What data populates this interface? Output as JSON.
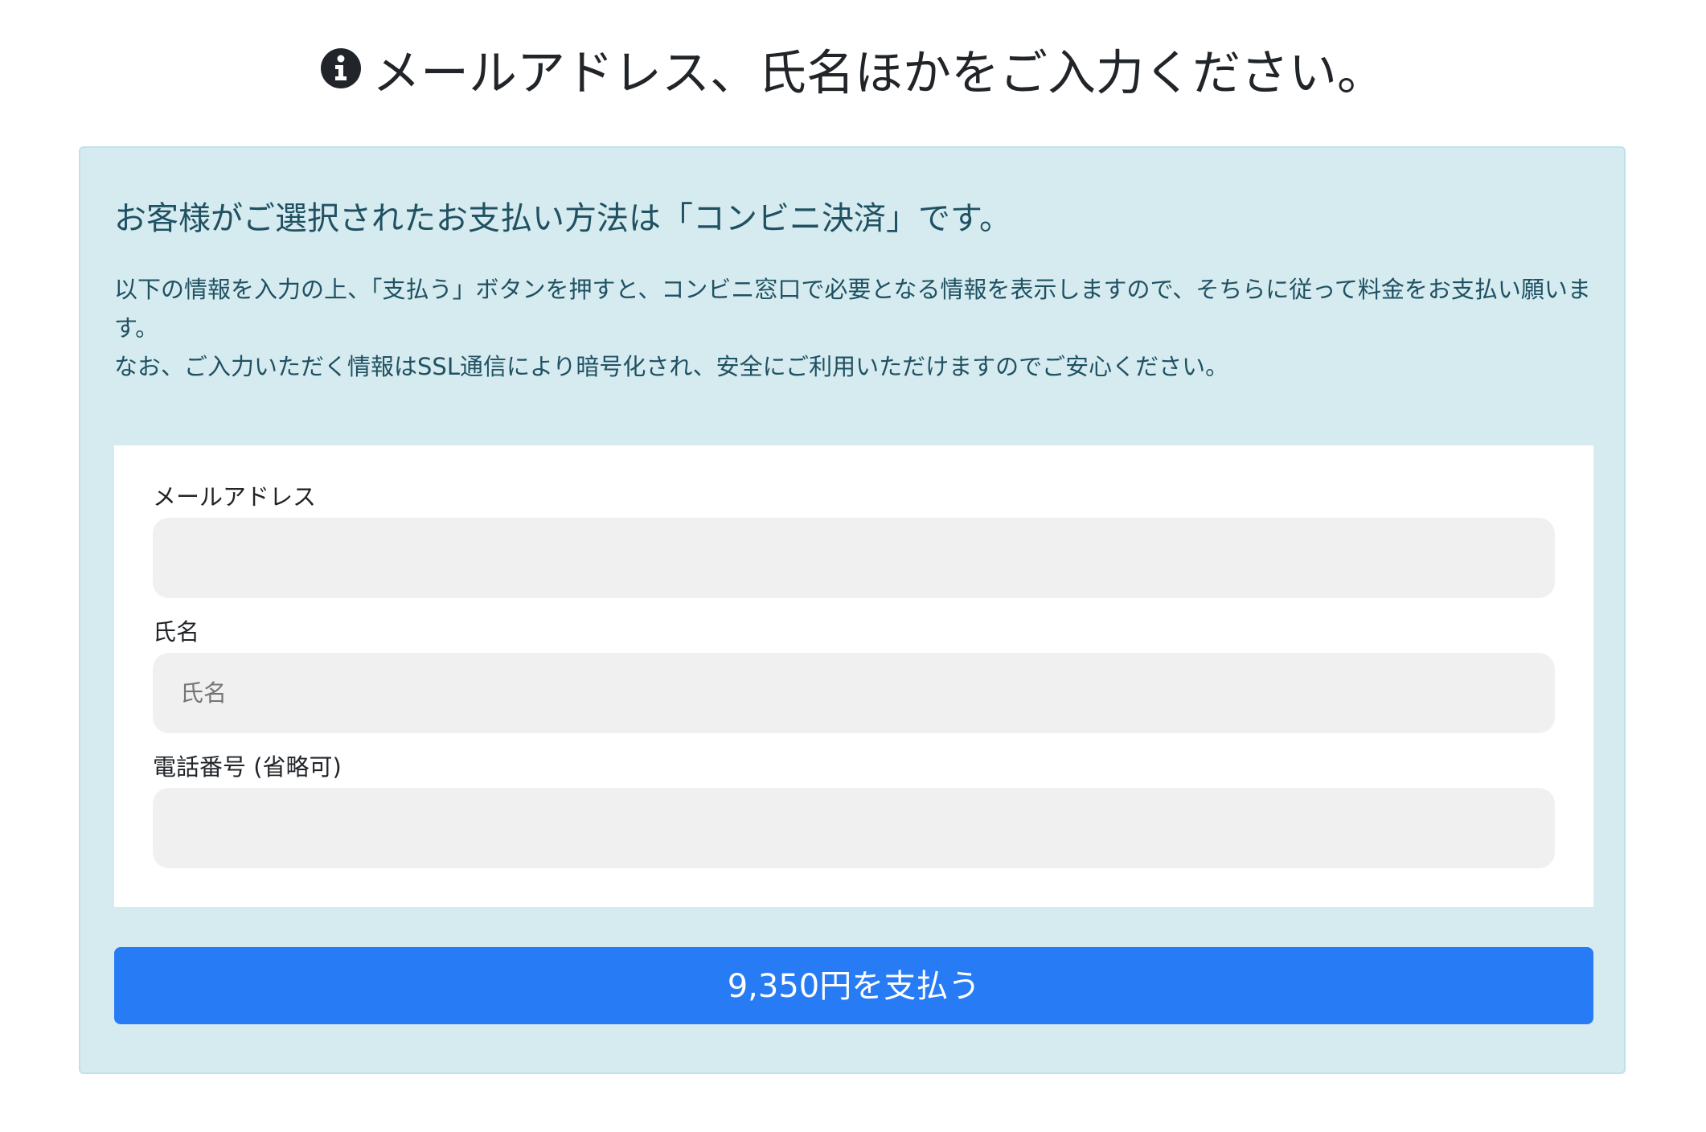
{
  "header": {
    "icon": "info-circle-icon",
    "title": "メールアドレス、氏名ほかをご入力ください。"
  },
  "notice": {
    "heading": "お客様がご選択されたお支払い方法は「コンビニ決済」です。",
    "paragraph_1": "以下の情報を入力の上、「支払う」ボタンを押すと、コンビニ窓口で必要となる情報を表示しますので、そちらに従って料金をお支払い願います。",
    "paragraph_2": "なお、ご入力いただく情報はSSL通信により暗号化され、安全にご利用いただけますのでご安心ください。"
  },
  "form": {
    "email": {
      "label": "メールアドレス",
      "value": "",
      "placeholder": ""
    },
    "name": {
      "label": "氏名",
      "value": "",
      "placeholder": "氏名"
    },
    "phone": {
      "label": "電話番号 (省略可)",
      "value": "",
      "placeholder": ""
    }
  },
  "pay_button": {
    "label": "9,350円を支払う"
  },
  "colors": {
    "panel_background": "#d6ebf0",
    "panel_text": "#1f5162",
    "input_background": "#f0f0f0",
    "button_primary": "#277cf6"
  }
}
